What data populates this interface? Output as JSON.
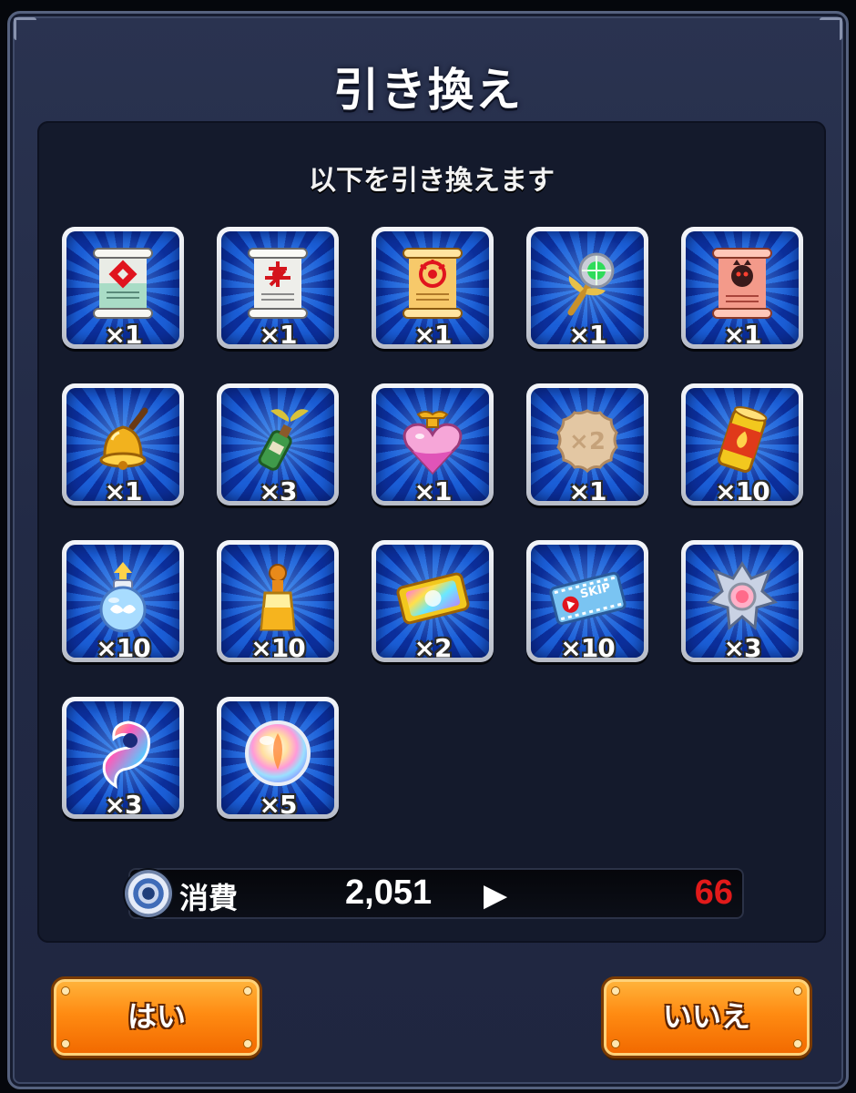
{
  "dialog": {
    "title": "引き換え",
    "subtitle": "以下を引き換えます"
  },
  "items": [
    {
      "icon": "scroll-red-rune-icon",
      "qty": "×1"
    },
    {
      "icon": "scroll-white-rune-icon",
      "qty": "×1"
    },
    {
      "icon": "scroll-gold-rune-icon",
      "qty": "×1"
    },
    {
      "icon": "magic-wand-icon",
      "qty": "×1"
    },
    {
      "icon": "scroll-pink-rune-icon",
      "qty": "×1"
    },
    {
      "icon": "golden-bell-icon",
      "qty": "×1"
    },
    {
      "icon": "sprout-bottle-icon",
      "qty": "×3"
    },
    {
      "icon": "heart-potion-icon",
      "qty": "×1"
    },
    {
      "icon": "cookie-x2-icon",
      "qty": "×1"
    },
    {
      "icon": "fire-can-icon",
      "qty": "×10"
    },
    {
      "icon": "winged-potion-icon",
      "qty": "×10"
    },
    {
      "icon": "orange-bottle-icon",
      "qty": "×10"
    },
    {
      "icon": "rainbow-ticket-icon",
      "qty": "×2"
    },
    {
      "icon": "skip-ticket-icon",
      "qty": "×10",
      "label": "SKIP"
    },
    {
      "icon": "silver-crest-icon",
      "qty": "×3"
    },
    {
      "icon": "rainbow-ribbon-icon",
      "qty": "×3"
    },
    {
      "icon": "rainbow-orb-icon",
      "qty": "×5"
    }
  ],
  "cost": {
    "label": "消費",
    "from": "2,051",
    "arrow": "▶",
    "to": "66",
    "to_color": "#e11a1a"
  },
  "buttons": {
    "yes": "はい",
    "no": "いいえ"
  }
}
